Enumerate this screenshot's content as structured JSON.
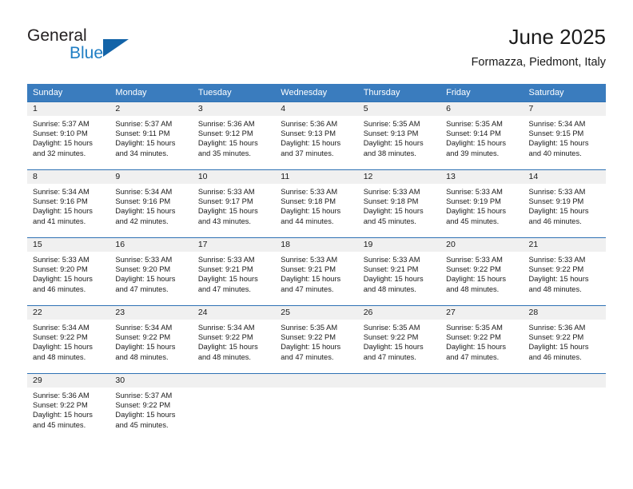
{
  "brand": {
    "name_part1": "General",
    "name_part2": "Blue",
    "triangle_color": "#1263a8",
    "blue_color": "#1f7ec4"
  },
  "header": {
    "title": "June 2025",
    "subtitle": "Formazza, Piedmont, Italy"
  },
  "theme": {
    "header_row_bg": "#3a7cbe",
    "row_divider": "#2f72b4",
    "daynum_strip_bg": "#f0f0f0",
    "text": "#1a1a1a"
  },
  "weekday_headers": [
    "Sunday",
    "Monday",
    "Tuesday",
    "Wednesday",
    "Thursday",
    "Friday",
    "Saturday"
  ],
  "weeks": [
    [
      {
        "day": "1",
        "sunrise": "Sunrise: 5:37 AM",
        "sunset": "Sunset: 9:10 PM",
        "daylight_1": "Daylight: 15 hours",
        "daylight_2": "and 32 minutes."
      },
      {
        "day": "2",
        "sunrise": "Sunrise: 5:37 AM",
        "sunset": "Sunset: 9:11 PM",
        "daylight_1": "Daylight: 15 hours",
        "daylight_2": "and 34 minutes."
      },
      {
        "day": "3",
        "sunrise": "Sunrise: 5:36 AM",
        "sunset": "Sunset: 9:12 PM",
        "daylight_1": "Daylight: 15 hours",
        "daylight_2": "and 35 minutes."
      },
      {
        "day": "4",
        "sunrise": "Sunrise: 5:36 AM",
        "sunset": "Sunset: 9:13 PM",
        "daylight_1": "Daylight: 15 hours",
        "daylight_2": "and 37 minutes."
      },
      {
        "day": "5",
        "sunrise": "Sunrise: 5:35 AM",
        "sunset": "Sunset: 9:13 PM",
        "daylight_1": "Daylight: 15 hours",
        "daylight_2": "and 38 minutes."
      },
      {
        "day": "6",
        "sunrise": "Sunrise: 5:35 AM",
        "sunset": "Sunset: 9:14 PM",
        "daylight_1": "Daylight: 15 hours",
        "daylight_2": "and 39 minutes."
      },
      {
        "day": "7",
        "sunrise": "Sunrise: 5:34 AM",
        "sunset": "Sunset: 9:15 PM",
        "daylight_1": "Daylight: 15 hours",
        "daylight_2": "and 40 minutes."
      }
    ],
    [
      {
        "day": "8",
        "sunrise": "Sunrise: 5:34 AM",
        "sunset": "Sunset: 9:16 PM",
        "daylight_1": "Daylight: 15 hours",
        "daylight_2": "and 41 minutes."
      },
      {
        "day": "9",
        "sunrise": "Sunrise: 5:34 AM",
        "sunset": "Sunset: 9:16 PM",
        "daylight_1": "Daylight: 15 hours",
        "daylight_2": "and 42 minutes."
      },
      {
        "day": "10",
        "sunrise": "Sunrise: 5:33 AM",
        "sunset": "Sunset: 9:17 PM",
        "daylight_1": "Daylight: 15 hours",
        "daylight_2": "and 43 minutes."
      },
      {
        "day": "11",
        "sunrise": "Sunrise: 5:33 AM",
        "sunset": "Sunset: 9:18 PM",
        "daylight_1": "Daylight: 15 hours",
        "daylight_2": "and 44 minutes."
      },
      {
        "day": "12",
        "sunrise": "Sunrise: 5:33 AM",
        "sunset": "Sunset: 9:18 PM",
        "daylight_1": "Daylight: 15 hours",
        "daylight_2": "and 45 minutes."
      },
      {
        "day": "13",
        "sunrise": "Sunrise: 5:33 AM",
        "sunset": "Sunset: 9:19 PM",
        "daylight_1": "Daylight: 15 hours",
        "daylight_2": "and 45 minutes."
      },
      {
        "day": "14",
        "sunrise": "Sunrise: 5:33 AM",
        "sunset": "Sunset: 9:19 PM",
        "daylight_1": "Daylight: 15 hours",
        "daylight_2": "and 46 minutes."
      }
    ],
    [
      {
        "day": "15",
        "sunrise": "Sunrise: 5:33 AM",
        "sunset": "Sunset: 9:20 PM",
        "daylight_1": "Daylight: 15 hours",
        "daylight_2": "and 46 minutes."
      },
      {
        "day": "16",
        "sunrise": "Sunrise: 5:33 AM",
        "sunset": "Sunset: 9:20 PM",
        "daylight_1": "Daylight: 15 hours",
        "daylight_2": "and 47 minutes."
      },
      {
        "day": "17",
        "sunrise": "Sunrise: 5:33 AM",
        "sunset": "Sunset: 9:21 PM",
        "daylight_1": "Daylight: 15 hours",
        "daylight_2": "and 47 minutes."
      },
      {
        "day": "18",
        "sunrise": "Sunrise: 5:33 AM",
        "sunset": "Sunset: 9:21 PM",
        "daylight_1": "Daylight: 15 hours",
        "daylight_2": "and 47 minutes."
      },
      {
        "day": "19",
        "sunrise": "Sunrise: 5:33 AM",
        "sunset": "Sunset: 9:21 PM",
        "daylight_1": "Daylight: 15 hours",
        "daylight_2": "and 48 minutes."
      },
      {
        "day": "20",
        "sunrise": "Sunrise: 5:33 AM",
        "sunset": "Sunset: 9:22 PM",
        "daylight_1": "Daylight: 15 hours",
        "daylight_2": "and 48 minutes."
      },
      {
        "day": "21",
        "sunrise": "Sunrise: 5:33 AM",
        "sunset": "Sunset: 9:22 PM",
        "daylight_1": "Daylight: 15 hours",
        "daylight_2": "and 48 minutes."
      }
    ],
    [
      {
        "day": "22",
        "sunrise": "Sunrise: 5:34 AM",
        "sunset": "Sunset: 9:22 PM",
        "daylight_1": "Daylight: 15 hours",
        "daylight_2": "and 48 minutes."
      },
      {
        "day": "23",
        "sunrise": "Sunrise: 5:34 AM",
        "sunset": "Sunset: 9:22 PM",
        "daylight_1": "Daylight: 15 hours",
        "daylight_2": "and 48 minutes."
      },
      {
        "day": "24",
        "sunrise": "Sunrise: 5:34 AM",
        "sunset": "Sunset: 9:22 PM",
        "daylight_1": "Daylight: 15 hours",
        "daylight_2": "and 48 minutes."
      },
      {
        "day": "25",
        "sunrise": "Sunrise: 5:35 AM",
        "sunset": "Sunset: 9:22 PM",
        "daylight_1": "Daylight: 15 hours",
        "daylight_2": "and 47 minutes."
      },
      {
        "day": "26",
        "sunrise": "Sunrise: 5:35 AM",
        "sunset": "Sunset: 9:22 PM",
        "daylight_1": "Daylight: 15 hours",
        "daylight_2": "and 47 minutes."
      },
      {
        "day": "27",
        "sunrise": "Sunrise: 5:35 AM",
        "sunset": "Sunset: 9:22 PM",
        "daylight_1": "Daylight: 15 hours",
        "daylight_2": "and 47 minutes."
      },
      {
        "day": "28",
        "sunrise": "Sunrise: 5:36 AM",
        "sunset": "Sunset: 9:22 PM",
        "daylight_1": "Daylight: 15 hours",
        "daylight_2": "and 46 minutes."
      }
    ],
    [
      {
        "day": "29",
        "sunrise": "Sunrise: 5:36 AM",
        "sunset": "Sunset: 9:22 PM",
        "daylight_1": "Daylight: 15 hours",
        "daylight_2": "and 45 minutes."
      },
      {
        "day": "30",
        "sunrise": "Sunrise: 5:37 AM",
        "sunset": "Sunset: 9:22 PM",
        "daylight_1": "Daylight: 15 hours",
        "daylight_2": "and 45 minutes."
      },
      {
        "day": "",
        "sunrise": "",
        "sunset": "",
        "daylight_1": "",
        "daylight_2": ""
      },
      {
        "day": "",
        "sunrise": "",
        "sunset": "",
        "daylight_1": "",
        "daylight_2": ""
      },
      {
        "day": "",
        "sunrise": "",
        "sunset": "",
        "daylight_1": "",
        "daylight_2": ""
      },
      {
        "day": "",
        "sunrise": "",
        "sunset": "",
        "daylight_1": "",
        "daylight_2": ""
      },
      {
        "day": "",
        "sunrise": "",
        "sunset": "",
        "daylight_1": "",
        "daylight_2": ""
      }
    ]
  ]
}
